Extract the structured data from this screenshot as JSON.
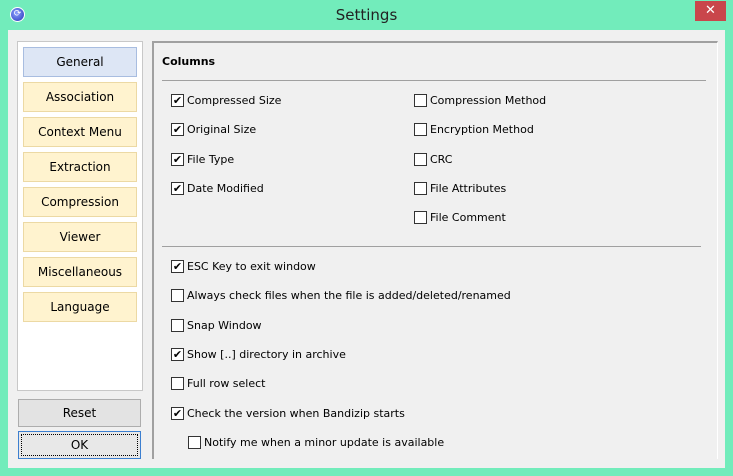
{
  "window": {
    "title": "Settings",
    "close": "✕",
    "icon": "⟳"
  },
  "nav": [
    "General",
    "Association",
    "Context Menu",
    "Extraction",
    "Compression",
    "Viewer",
    "Miscellaneous",
    "Language"
  ],
  "buttons": {
    "reset": "Reset",
    "ok": "OK"
  },
  "columns": {
    "heading": "Columns",
    "left": [
      {
        "label": "Compressed Size",
        "checked": true
      },
      {
        "label": "Original Size",
        "checked": true
      },
      {
        "label": "File Type",
        "checked": true
      },
      {
        "label": "Date Modified",
        "checked": true
      }
    ],
    "right": [
      {
        "label": "Compression Method",
        "checked": false
      },
      {
        "label": "Encryption Method",
        "checked": false
      },
      {
        "label": "CRC",
        "checked": false
      },
      {
        "label": "File Attributes",
        "checked": false
      },
      {
        "label": "File Comment",
        "checked": false
      }
    ]
  },
  "options": [
    {
      "label": "ESC Key to exit window",
      "checked": true
    },
    {
      "label": "Always check files when the file is added/deleted/renamed",
      "checked": false
    },
    {
      "label": "Snap Window",
      "checked": false
    },
    {
      "label": "Show [..] directory in archive",
      "checked": true
    },
    {
      "label": "Full row select",
      "checked": false
    },
    {
      "label": "Check the version when Bandizip starts",
      "checked": true
    },
    {
      "label": "Notify me when a minor update is available",
      "checked": false
    }
  ]
}
